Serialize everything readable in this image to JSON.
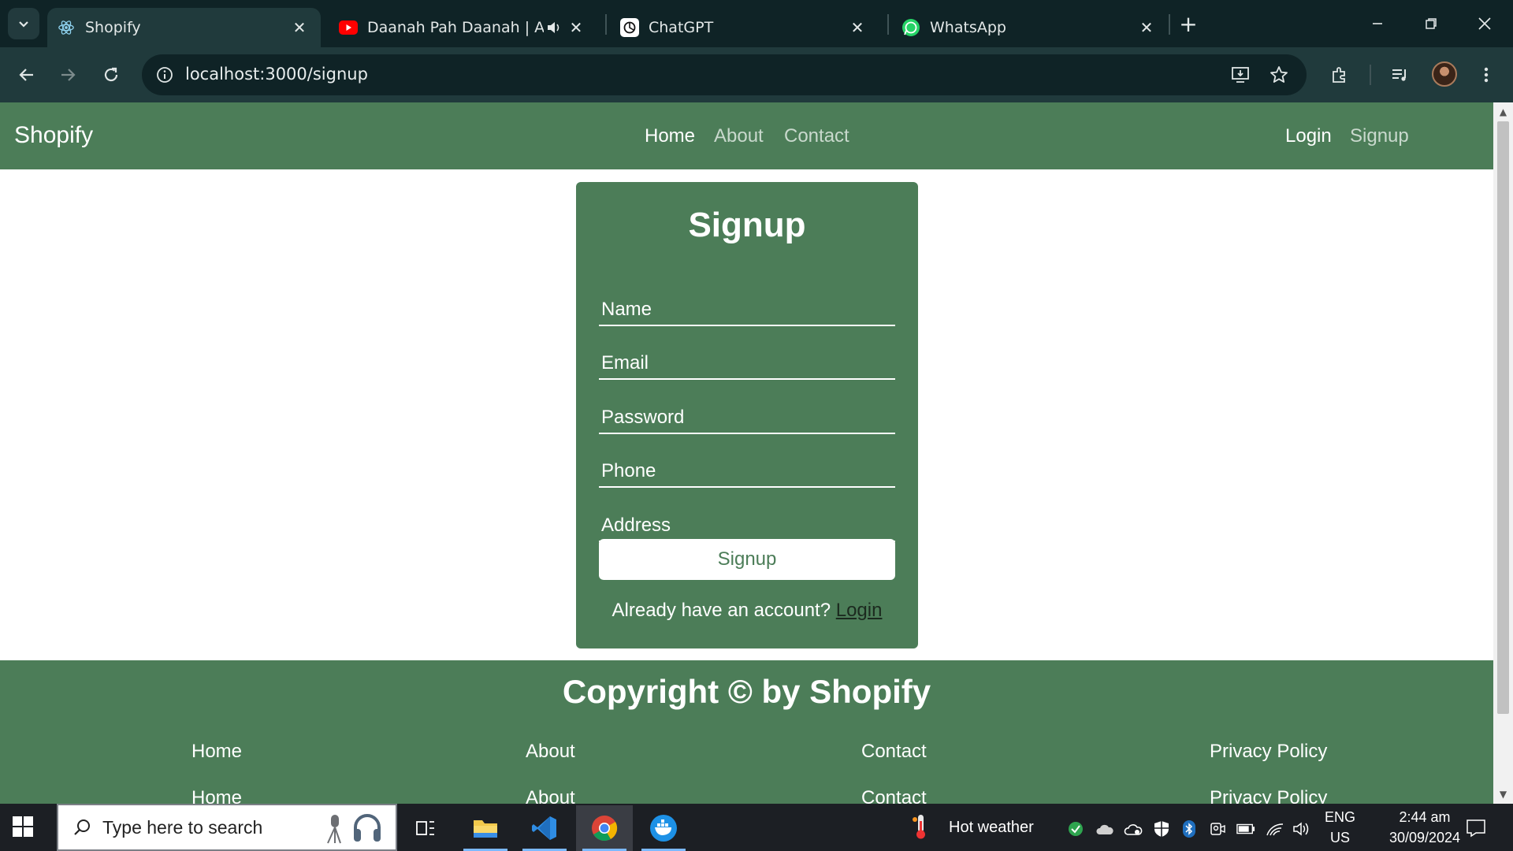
{
  "browser": {
    "tabs": [
      {
        "title": "Shopify",
        "active": true,
        "icon": "react-icon"
      },
      {
        "title": "Daanah Pah Daanah | Akhta",
        "active": false,
        "icon": "youtube-icon",
        "audio": true
      },
      {
        "title": "ChatGPT",
        "active": false,
        "icon": "chatgpt-icon"
      },
      {
        "title": "WhatsApp",
        "active": false,
        "icon": "whatsapp-icon"
      }
    ],
    "url": "localhost:3000/signup"
  },
  "navbar": {
    "brand": "Shopify",
    "links": [
      "Home",
      "About",
      "Contact"
    ],
    "auth": [
      "Login",
      "Signup"
    ]
  },
  "form": {
    "title": "Signup",
    "fields": [
      "Name",
      "Email",
      "Password",
      "Phone",
      "Address"
    ],
    "submit_label": "Signup",
    "login_prompt": "Already have an account?",
    "login_link": "Login"
  },
  "footer": {
    "copyright": "Copyright © by Shopify",
    "row1": [
      "Home",
      "About",
      "Contact",
      "Privacy Policy"
    ],
    "row2": [
      "Home",
      "About",
      "Contact",
      "Privacy Policy"
    ]
  },
  "taskbar": {
    "search_placeholder": "Type here to search",
    "weather": "Hot weather",
    "lang": "ENG",
    "region": "US",
    "time": "2:44 am",
    "date": "30/09/2024"
  },
  "colors": {
    "brand_green": "#4c7d58",
    "chrome_dark": "#0f2326",
    "chrome_toolbar": "#203a3c"
  }
}
